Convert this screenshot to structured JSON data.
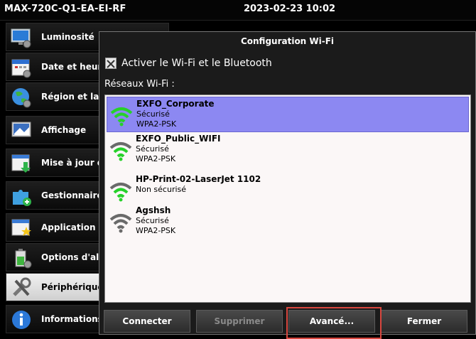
{
  "topbar": {
    "device": "MAX-720C-Q1-EA-EI-RF",
    "datetime": "2023-02-23 10:02"
  },
  "sidebar": {
    "items": [
      {
        "label": "Luminosité",
        "icon": "monitor-gear-icon"
      },
      {
        "label": "Date et heure",
        "icon": "calendar-icon"
      },
      {
        "label": "Région et lan",
        "icon": "globe-icon"
      },
      {
        "label": "Affichage",
        "icon": "display-icon"
      },
      {
        "label": "Mise à jour du",
        "icon": "update-download-icon"
      },
      {
        "label": "Gestionnaire c",
        "icon": "puzzle-icon"
      },
      {
        "label": "Application de",
        "icon": "app-star-icon"
      },
      {
        "label": "Options d'alim",
        "icon": "battery-icon"
      },
      {
        "label": "Périphériques",
        "icon": "tools-icon",
        "active": true
      },
      {
        "label": "Informations système",
        "icon": "info-icon"
      }
    ]
  },
  "dialog": {
    "title": "Configuration Wi-Fi",
    "enable_label": "Activer le Wi-Fi et le Bluetooth",
    "enable_checked": true,
    "networks_label": "Réseaux Wi-Fi :",
    "networks": [
      {
        "name": "EXFO_Corporate",
        "security": "Sécurisé",
        "auth": "WPA2-PSK",
        "selected": true,
        "signal": 3
      },
      {
        "name": "EXFO_Public_WIFI",
        "security": "Sécurisé",
        "auth": "WPA2-PSK",
        "selected": false,
        "signal": 3
      },
      {
        "name": "HP-Print-02-LaserJet 1102",
        "security": "Non sécurisé",
        "auth": "",
        "selected": false,
        "signal": 3
      },
      {
        "name": "Agshsh",
        "security": "Sécurisé",
        "auth": "WPA2-PSK",
        "selected": false,
        "signal": 0
      }
    ],
    "buttons": {
      "connect": "Connecter",
      "delete": "Supprimer",
      "advanced": "Avancé...",
      "close": "Fermer"
    }
  },
  "colors": {
    "selection": "#8c88f2",
    "wifi_green": "#26d12a",
    "wifi_gray": "#6a6a6a",
    "highlight": "#d9473f"
  }
}
